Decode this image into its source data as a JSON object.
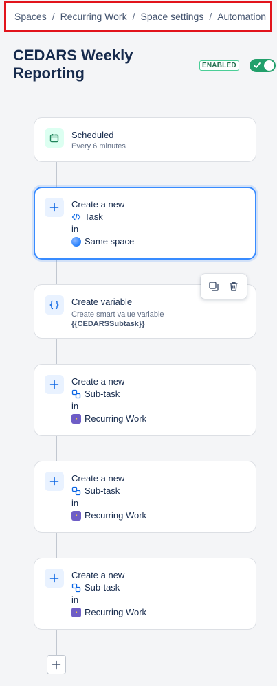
{
  "breadcrumb": {
    "items": [
      "Spaces",
      "Recurring Work",
      "Space settings",
      "Automation"
    ],
    "separator": "/"
  },
  "header": {
    "title": "CEDARS Weekly Reporting",
    "status_badge": "ENABLED",
    "toggle_on": true
  },
  "colors": {
    "accent": "#388bff",
    "enabled_green": "#22a06b",
    "breadcrumb_highlight": "#e2141c"
  },
  "steps": [
    {
      "type": "trigger",
      "icon": "calendar-icon",
      "title": "Scheduled",
      "subtitle": "Every 6 minutes"
    },
    {
      "type": "action",
      "icon": "plus-icon",
      "line1": "Create a new",
      "issue_type_icon": "code-icon",
      "issue_type": "Task",
      "in_label": "in",
      "space_icon": "globe-icon",
      "space": "Same space",
      "selected": true
    },
    {
      "type": "variable",
      "icon": "braces-icon",
      "title": "Create variable",
      "subtitle": "Create smart value variable",
      "variable": "{{CEDARSSubtask}}"
    },
    {
      "type": "action",
      "icon": "plus-icon",
      "line1": "Create a new",
      "issue_type_icon": "subtask-icon",
      "issue_type": "Sub-task",
      "in_label": "in",
      "space_icon": "space-icon",
      "space": "Recurring Work"
    },
    {
      "type": "action",
      "icon": "plus-icon",
      "line1": "Create a new",
      "issue_type_icon": "subtask-icon",
      "issue_type": "Sub-task",
      "in_label": "in",
      "space_icon": "space-icon",
      "space": "Recurring Work"
    },
    {
      "type": "action",
      "icon": "plus-icon",
      "line1": "Create a new",
      "issue_type_icon": "subtask-icon",
      "issue_type": "Sub-task",
      "in_label": "in",
      "space_icon": "space-icon",
      "space": "Recurring Work"
    }
  ],
  "toolbar": {
    "icons": [
      "copy-icon",
      "trash-icon"
    ]
  },
  "add_component": {
    "icon": "plus-icon"
  }
}
